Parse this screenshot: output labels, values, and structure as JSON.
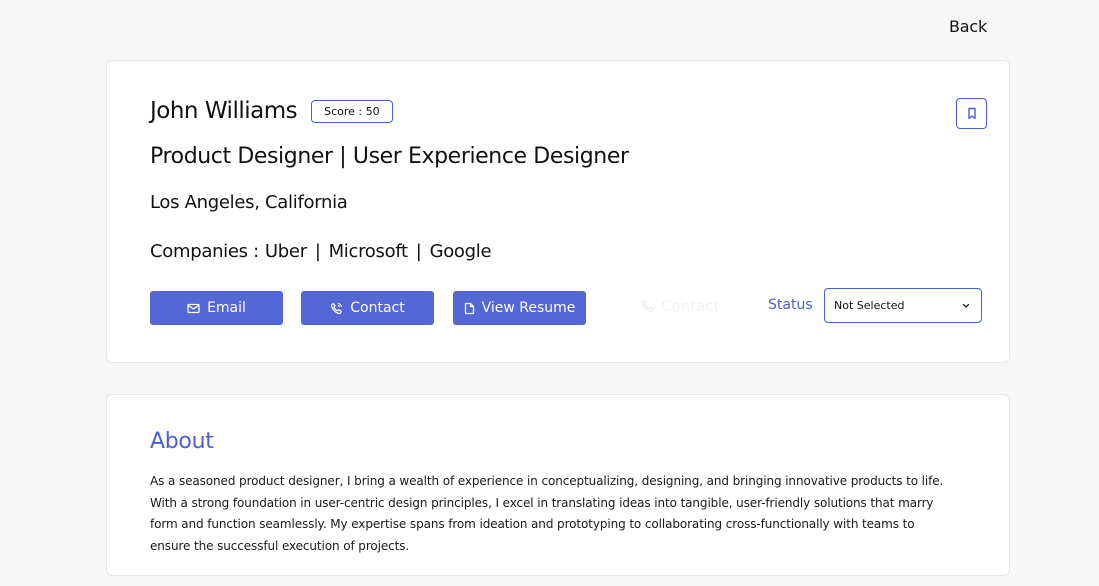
{
  "nav": {
    "back_label": "Back"
  },
  "profile": {
    "name": "John Williams",
    "score_label": "Score : 50",
    "title": "Product Designer | User Experience Designer",
    "location": "Los Angeles, California",
    "companies_label": "Companies :",
    "companies": [
      "Uber",
      "Microsoft",
      "Google"
    ],
    "separator": "|"
  },
  "actions": {
    "email_label": "Email",
    "contact_label": "Contact",
    "resume_label": "View Resume",
    "ghost_contact_label": "Contact"
  },
  "status": {
    "label": "Status",
    "selected": "Not Selected"
  },
  "about": {
    "title": "About",
    "text": "As a seasoned product designer, I bring a wealth of experience in conceptualizing, designing, and bringing innovative products to life. With a strong foundation in user-centric design principles, I excel in translating ideas into tangible, user-friendly solutions that marry form and function seamlessly. My expertise spans from ideation and prototyping to collaborating cross-functionally with teams to ensure the successful execution of projects."
  },
  "colors": {
    "accent": "#5566d6",
    "accent_text": "#4b5fcf",
    "background": "#f7f7f7",
    "card": "#ffffff"
  },
  "icons": [
    "bookmark-icon",
    "mail-icon",
    "phone-icon",
    "document-icon",
    "chevron-down-icon"
  ]
}
